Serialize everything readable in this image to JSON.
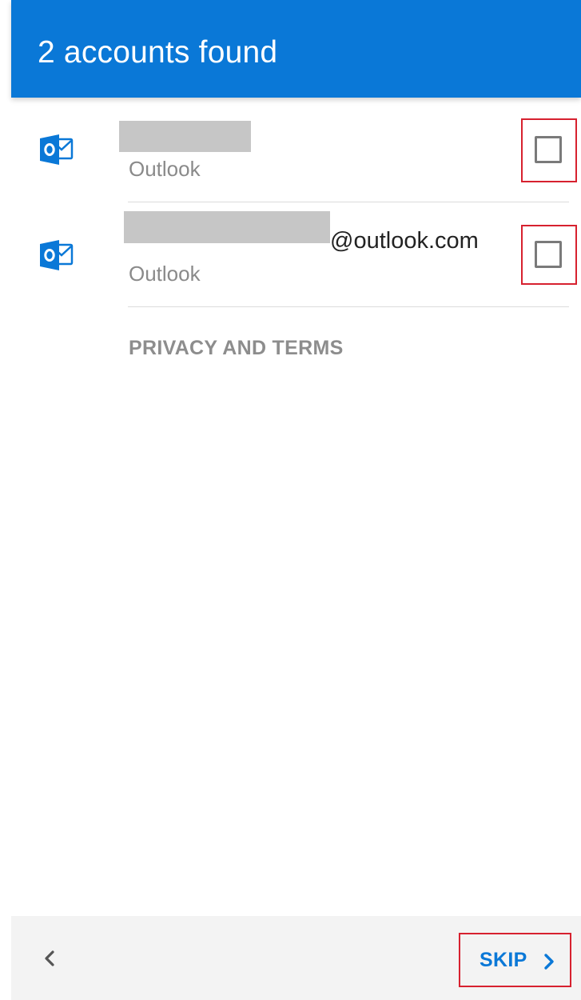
{
  "header": {
    "title": "2 accounts found",
    "background_color": "#0a78d7"
  },
  "accounts": [
    {
      "email_visible_suffix": "",
      "email_redacted": true,
      "type_label": "Outlook",
      "icon": "outlook-icon",
      "checked": false
    },
    {
      "email_visible_suffix": "@outlook.com",
      "email_redacted": true,
      "type_label": "Outlook",
      "icon": "outlook-icon",
      "checked": false
    }
  ],
  "links": {
    "privacy_terms": "PRIVACY AND TERMS"
  },
  "footer": {
    "back_icon": "chevron-left-icon",
    "skip_label": "SKIP",
    "skip_icon": "chevron-right-icon",
    "accent_color": "#0a78d7",
    "highlight_color": "#d7212f"
  }
}
